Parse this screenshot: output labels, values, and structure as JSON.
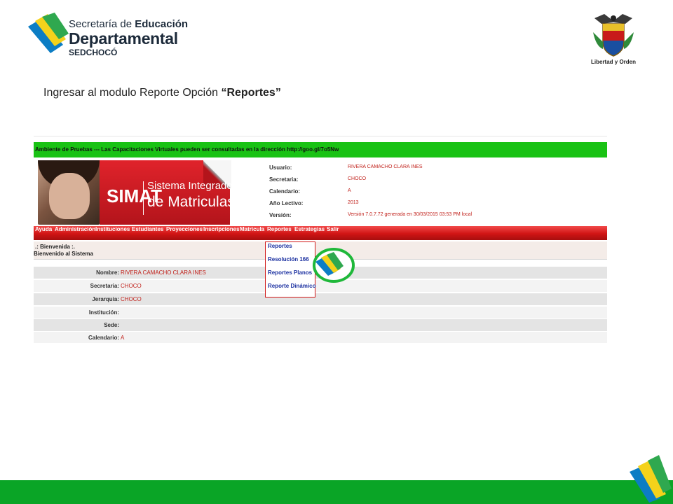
{
  "logo": {
    "line1_normal": "Secretaría de ",
    "line1_bold": "Educación",
    "line2": "Departamental",
    "line3": "SEDCHOCÓ"
  },
  "crest": {
    "caption": "Libertad y Orden"
  },
  "instruction": {
    "text": "Ingresar al modulo Reporte Opción ",
    "emphasis": "“Reportes”"
  },
  "app": {
    "notice": "Ambiente de Pruebas --- Las Capacitaciones Virtuales pueden ser consultadas en la dirección http://goo.gl/7o5Nw",
    "banner": {
      "brand": "SIMAT",
      "title_line1": "Sistema Integrado",
      "title_line2": "de Matriculas"
    },
    "user_info": [
      {
        "label": "Usuario:",
        "value": "RIVERA CAMACHO CLARA INES"
      },
      {
        "label": "Secretaria:",
        "value": "CHOCO"
      },
      {
        "label": "Calendario:",
        "value": "A"
      },
      {
        "label": "Año Lectivo:",
        "value": "2013"
      },
      {
        "label": "Versión:",
        "value": "Versión 7.0.7.72 generada en 30/03/2015 03:53 PM local"
      }
    ],
    "menu": [
      "Ayuda",
      "Administración",
      "Instituciones",
      "Estudiantes",
      "Proyecciones",
      "Inscripciones",
      "Matricula",
      "Reportes",
      "Estrategias",
      "Salir"
    ],
    "welcome": {
      "line1": ".: Bienvenida :.",
      "line2": "Bienvenido al Sistema"
    },
    "info_rows": [
      {
        "label": "Nombre:",
        "value": "RIVERA CAMACHO CLARA INES"
      },
      {
        "label": "Secretaria:",
        "value": "CHOCO"
      },
      {
        "label": "Jerarquia:",
        "value": "CHOCO"
      },
      {
        "label": "Institución:",
        "value": ""
      },
      {
        "label": "Sede:",
        "value": ""
      },
      {
        "label": "Calendario:",
        "value": "A"
      }
    ],
    "dropdown": [
      "Reportes",
      "Resolución 166",
      "Reportes Planos",
      "Reporte Dinámico"
    ]
  },
  "colors": {
    "footer_green": "#0aa526",
    "notice_green": "#19c214",
    "menu_red": "#d01414",
    "value_red": "#c0201a",
    "dropdown_blue": "#1a2fa0"
  }
}
